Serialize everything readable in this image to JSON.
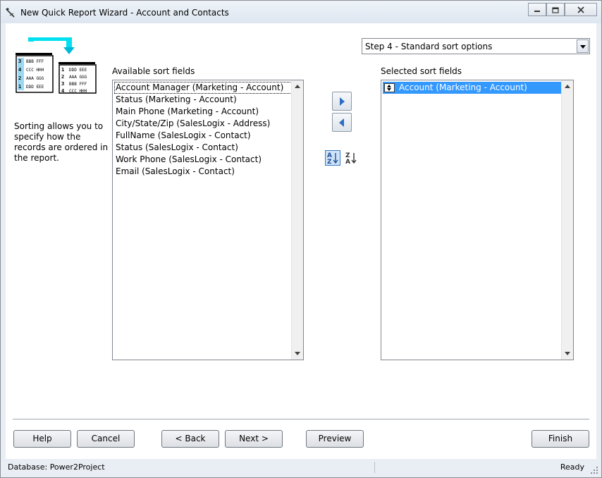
{
  "window": {
    "title": "New Quick Report Wizard - Account and Contacts",
    "icons": [
      "wizard-icon",
      "minimize-icon",
      "restore-icon",
      "close-icon"
    ]
  },
  "step_select": {
    "selected": "Step 4 - Standard sort options"
  },
  "illustration": {
    "icon": "sort-records-illustration",
    "left_rows": [
      {
        "num": "3",
        "code": "BBB FFF"
      },
      {
        "num": "4",
        "code": "CCC HHH"
      },
      {
        "num": "2",
        "code": "AAA GGG"
      },
      {
        "num": "1",
        "code": "DDD EEE"
      }
    ],
    "right_rows": [
      {
        "num": "1",
        "code": "DDD EEE"
      },
      {
        "num": "2",
        "code": "AAA GGG"
      },
      {
        "num": "3",
        "code": "BBB FFF"
      },
      {
        "num": "4",
        "code": "CCC HHH"
      }
    ]
  },
  "description": [
    "Sorting allows you to",
    "specify how the",
    "records are ordered in",
    "the report."
  ],
  "available": {
    "label": "Available sort fields",
    "items": [
      "Account Manager (Marketing - Account)",
      "Status (Marketing - Account)",
      "Main Phone (Marketing - Account)",
      "City/State/Zip (SalesLogix - Address)",
      "FullName (SalesLogix - Contact)",
      "Status (SalesLogix - Contact)",
      "Work Phone (SalesLogix - Contact)",
      "Email (SalesLogix - Contact)"
    ]
  },
  "selected": {
    "label": "Selected sort fields",
    "items": [
      "Account (Marketing - Account)"
    ]
  },
  "sort_buttons": {
    "ascending": {
      "top": "A",
      "bottom": "Z"
    },
    "descending": {
      "top": "Z",
      "bottom": "A"
    }
  },
  "buttons": {
    "help": "Help",
    "cancel": "Cancel",
    "back": "< Back",
    "next": "Next >",
    "preview": "Preview",
    "finish": "Finish"
  },
  "status": {
    "database": "Database: Power2Project",
    "state": "Ready"
  }
}
